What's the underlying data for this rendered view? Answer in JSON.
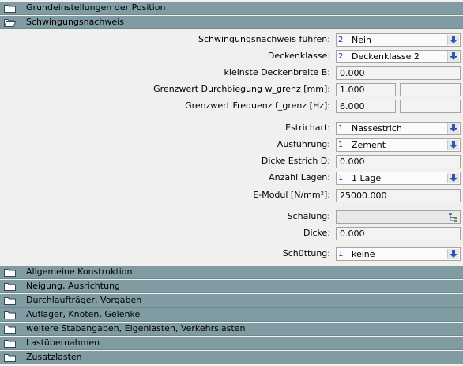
{
  "sections_top": [
    {
      "title": "Grundeinstellungen der Position",
      "open": false
    },
    {
      "title": "Schwingungsnachweis",
      "open": true
    }
  ],
  "form": {
    "schwingungsnachweis_fuehren": {
      "label": "Schwingungsnachweis führen:",
      "num": "2",
      "value": "Nein"
    },
    "deckenklasse": {
      "label": "Deckenklasse:",
      "num": "2",
      "value": "Deckenklasse 2"
    },
    "kleinste_deckenbreite": {
      "label": "kleinste Deckenbreite B:",
      "value": "0.000"
    },
    "grenzwert_durchbiegung": {
      "label": "Grenzwert Durchbiegung w_grenz [mm]:",
      "value": "1.000",
      "extra": ""
    },
    "grenzwert_frequenz": {
      "label": "Grenzwert Frequenz f_grenz [Hz]:",
      "value": "6.000",
      "extra": ""
    },
    "estrichart": {
      "label": "Estrichart:",
      "num": "1",
      "value": "Nassestrich"
    },
    "ausfuehrung": {
      "label": "Ausführung:",
      "num": "1",
      "value": "Zement"
    },
    "dicke_estrich": {
      "label": "Dicke Estrich D:",
      "value": "0.000"
    },
    "anzahl_lagen": {
      "label": "Anzahl Lagen:",
      "num": "1",
      "value": "1 Lage"
    },
    "e_modul": {
      "label": "E-Modul [N/mm²]:",
      "value": "25000.000"
    },
    "schalung": {
      "label": "Schalung:",
      "value": ""
    },
    "dicke": {
      "label": "Dicke:",
      "value": "0.000"
    },
    "schuettung": {
      "label": "Schüttung:",
      "num": "1",
      "value": "keine"
    }
  },
  "sections_bottom": [
    {
      "title": "Allgemeine Konstruktion"
    },
    {
      "title": "Neigung, Ausrichtung"
    },
    {
      "title": "Durchlaufträger, Vorgaben"
    },
    {
      "title": "Auflager, Knoten, Gelenke"
    },
    {
      "title": "weitere Stabangaben, Eigenlasten, Verkehrslasten"
    },
    {
      "title": "Lastübernahmen"
    },
    {
      "title": "Zusatzlasten"
    }
  ],
  "colors": {
    "header_bg": "#819ba2",
    "panel_bg": "#f0f0ef",
    "index_blue": "#1a2cb0"
  }
}
